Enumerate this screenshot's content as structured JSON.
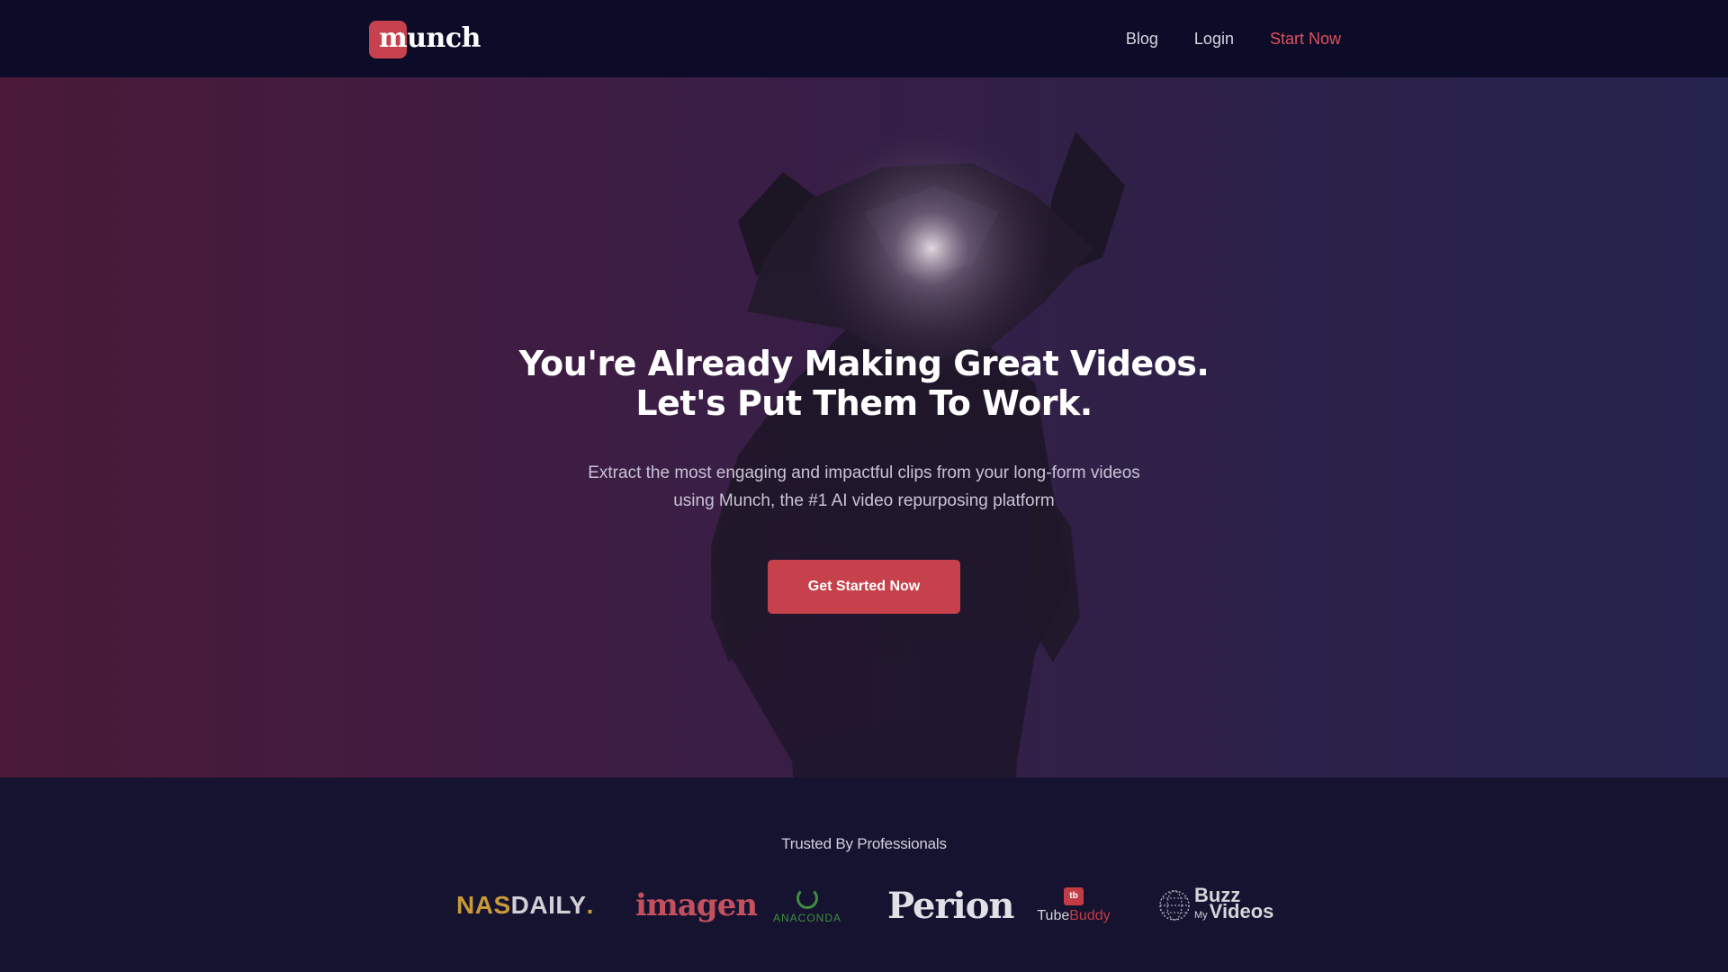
{
  "nav": {
    "logo_text": "munch",
    "links": [
      "Blog",
      "Login",
      "Start Now"
    ]
  },
  "hero": {
    "title_line1": "You're Already Making Great Videos.",
    "title_line2": "Let's Put Them To Work.",
    "subtitle": "Extract the most engaging and impactful clips from your long-form videos using Munch, the #1 AI video repurposing platform",
    "cta_label": "Get Started Now"
  },
  "trusted": {
    "title": "Trusted By Professionals",
    "brands": {
      "nasdaily_a": "NAS",
      "nasdaily_b": "DAILY",
      "nasdaily_c": ".",
      "imagen": "imagen",
      "anaconda": "ANACONDA",
      "perion": "Perion",
      "tubebuddy_icon": "tb",
      "tubebuddy_a": "Tube",
      "tubebuddy_b": "Buddy",
      "buzz_a": "Buzz",
      "buzz_my": "My",
      "buzz_b": "Videos"
    }
  },
  "colors": {
    "nav_bg": "#0c0c28",
    "accent": "#c7414c",
    "hero_left": "#4a1a38",
    "hero_right": "#25244e"
  },
  "icons": [
    "munch-logo",
    "anaconda-ring-icon",
    "tubebuddy-icon",
    "buzz-globe-icon"
  ]
}
